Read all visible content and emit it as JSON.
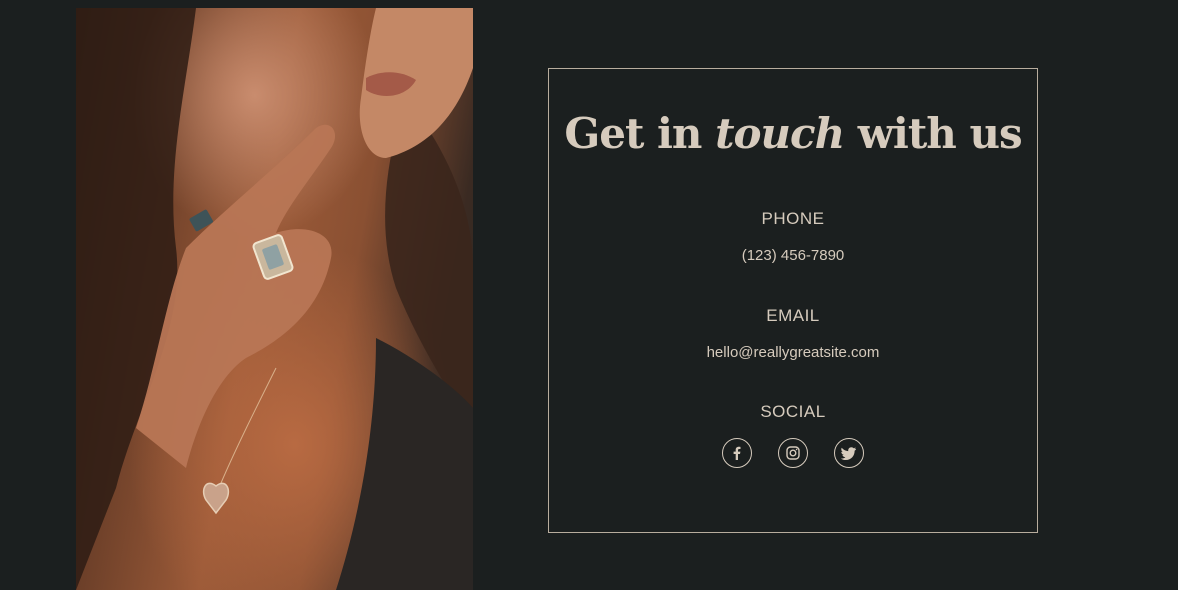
{
  "headline": {
    "part1": "Get in",
    "italic": "touch",
    "part2": "with us"
  },
  "contact": {
    "phone_label": "PHONE",
    "phone_value": "(123) 456-7890",
    "email_label": "EMAIL",
    "email_value": "hello@reallygreatsite.com",
    "social_label": "SOCIAL"
  },
  "social": [
    {
      "name": "facebook",
      "icon": "facebook-icon"
    },
    {
      "name": "instagram",
      "icon": "instagram-icon"
    },
    {
      "name": "twitter",
      "icon": "twitter-icon"
    }
  ],
  "colors": {
    "background": "#1b1f1f",
    "text": "#d6cbbd",
    "border": "#b8ad9e"
  }
}
